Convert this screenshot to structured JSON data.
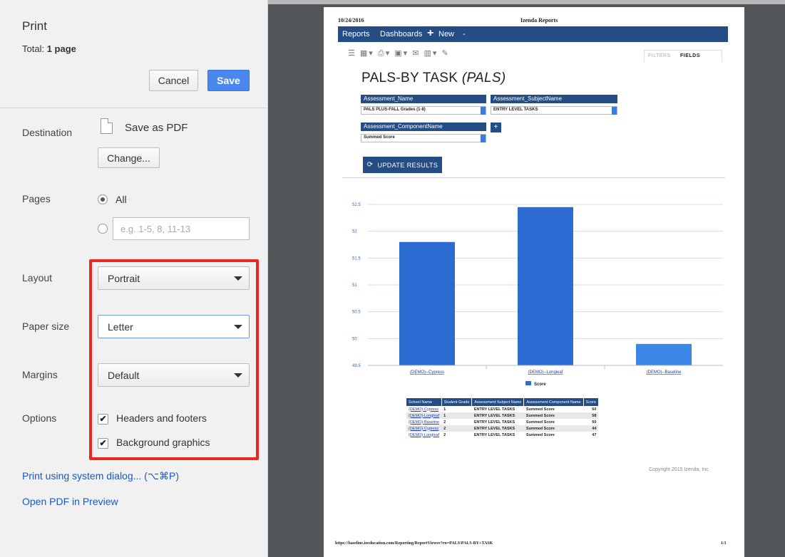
{
  "panel": {
    "title": "Print",
    "total_label": "Total:",
    "total_value": "1 page",
    "cancel_label": "Cancel",
    "save_label": "Save",
    "destination": {
      "label": "Destination",
      "name": "Save as PDF",
      "change_label": "Change..."
    },
    "pages": {
      "label": "Pages",
      "all_label": "All",
      "range_placeholder": "e.g. 1-5, 8, 11-13"
    },
    "layout": {
      "label": "Layout",
      "value": "Portrait"
    },
    "paper_size": {
      "label": "Paper size",
      "value": "Letter"
    },
    "margins": {
      "label": "Margins",
      "value": "Default"
    },
    "options": {
      "label": "Options",
      "headers_footers": "Headers and footers",
      "background_graphics": "Background graphics"
    },
    "system_dialog_link": "Print using system dialog... (⌥⌘P)",
    "open_pdf_link": "Open PDF in Preview",
    "highlight_color": "#e8271e"
  },
  "preview": {
    "date": "10/24/2016",
    "header_title": "Izenda Reports",
    "nav": {
      "reports": "Reports",
      "dashboards": "Dashboards",
      "new": "New",
      "plus": "+",
      "dropdown": "-"
    },
    "toolbar_icons": "☰ ▦▾ ⎙▾ ▣▾ ✉ ▥▾ ✎",
    "tabs": {
      "filters": "FILTERS",
      "fields": "FIELDS"
    },
    "report_title": "PALS-BY TASK",
    "report_title_italic": "(PALS)",
    "filters": [
      {
        "label": "Assessment_Name",
        "value": "PALS PLUS-FALL Grades (1-8)"
      },
      {
        "label": "Assessment_SubjectName",
        "value": "ENTRY LEVEL TASKS"
      },
      {
        "label": "Assessment_ComponentName",
        "value": "Summed Score"
      }
    ],
    "add_filter": "+",
    "update_label": "UPDATE RESULTS",
    "update_icon": "⟳",
    "table": {
      "headers": [
        "School Name",
        "Student Grade",
        "Assessment Subject Name",
        "Assessment Component Name",
        "Score"
      ],
      "rows": [
        [
          "(DEMO)-Cypress",
          "1",
          "ENTRY LEVEL TASKS",
          "Summed Score",
          "60"
        ],
        [
          "(DEMO)-Longleaf",
          "1",
          "ENTRY LEVEL TASKS",
          "Summed Score",
          "58"
        ],
        [
          "(DEMO)-Baseline",
          "2",
          "ENTRY LEVEL TASKS",
          "Summed Score",
          "50"
        ],
        [
          "(DEMO)-Cypress",
          "2",
          "ENTRY LEVEL TASKS",
          "Summed Score",
          "44"
        ],
        [
          "(DEMO)-Longleaf",
          "2",
          "ENTRY LEVEL TASKS",
          "Summed Score",
          "47"
        ]
      ]
    },
    "copyright": "Copyright 2015 Izenda, Inc.",
    "footer_url": "https://baseline.ioeducation.com/Reporting/ReportViewer?rn=PALS\\PALS-BY+TASK",
    "footer_page": "1/1"
  },
  "chart_data": {
    "type": "bar",
    "categories": [
      "(DEMO)--Cypress",
      "(DEMO)--Longleaf",
      "(DEMO)--Baseline"
    ],
    "series": [
      {
        "name": "Score",
        "values": [
          51.8,
          52.45,
          49.9
        ]
      }
    ],
    "ylim": [
      49.5,
      52.5
    ],
    "yticks": [
      "49.5",
      "50",
      "50.5",
      "51",
      "51.5",
      "52",
      "52.5"
    ],
    "legend": "bottom",
    "grid": true,
    "bar_colors": [
      "#2b6bd2",
      "#2b6bd2",
      "#3a87e6"
    ]
  }
}
